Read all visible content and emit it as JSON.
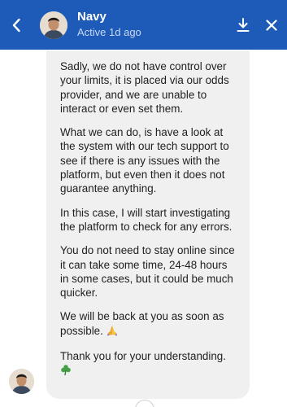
{
  "header": {
    "name": "Navy",
    "status": "Active 1d ago",
    "back_icon": "chevron-left-icon",
    "download_icon": "download-icon",
    "close_icon": "close-icon",
    "bg_color": "#1e5bb8"
  },
  "message": {
    "paragraphs": [
      "Sadly, we do not have control over your limits, it is placed via our odds provider, and we are unable to interact or even set them.",
      "What we can do, is have a look at the system with our tech support to see if there is any issues with the platform, but even then it does not guarantee anything.",
      "In this case, I will start investigating the platform to check for any errors.",
      "You do not need to stay online since it can take some time, 24-48 hours in some cases, but it could be much quicker.",
      "We will be back at you as soon as possible.",
      "Thank you for your understanding."
    ],
    "emoji_pray": "praying-hands-icon",
    "emoji_clover": "shamrock-icon",
    "bubble_color": "#f0f0f0"
  }
}
